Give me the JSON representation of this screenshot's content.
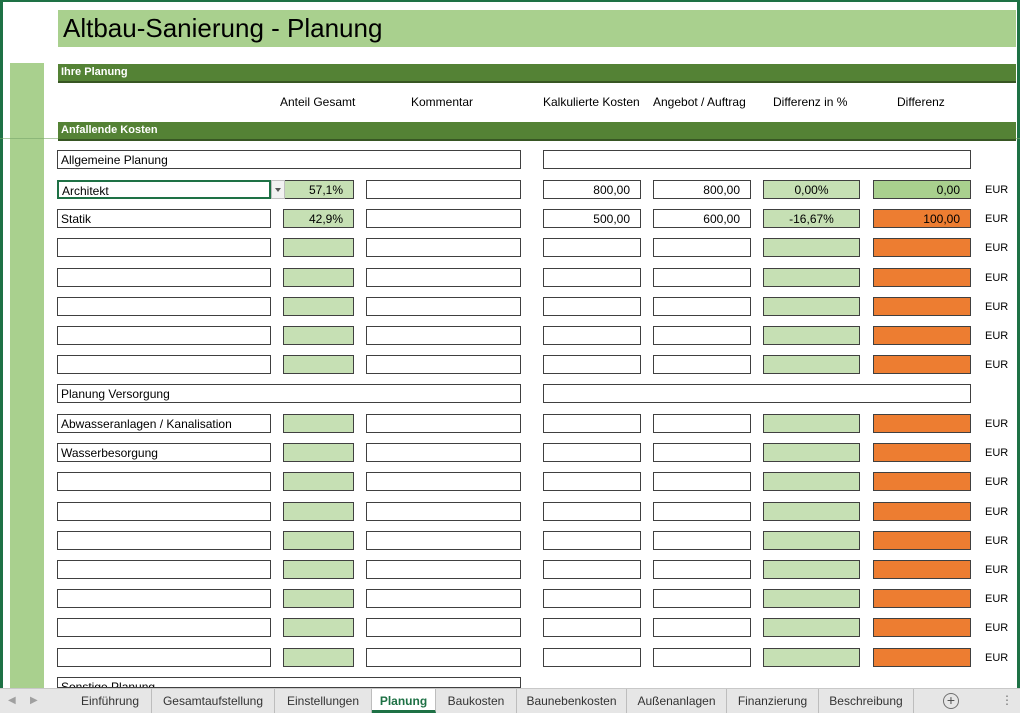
{
  "title": "Altbau-Sanierung - Planung",
  "sections": {
    "planning": "Ihre Planung",
    "costs": "Anfallende Kosten"
  },
  "columns": [
    "Anteil Gesamt",
    "Kommentar",
    "Kalkulierte Kosten",
    "Angebot / Auftrag",
    "Differenz in %",
    "Differenz"
  ],
  "currency": "EUR",
  "groups": [
    {
      "label": "Allgemeine Planung"
    },
    {
      "label": "Planung Versorgung"
    },
    {
      "label": "Sonstige Planung"
    }
  ],
  "rows": [
    {
      "name": "Architekt",
      "anteil": "57,1%",
      "kommentar": "",
      "kalkuliert": "800,00",
      "angebot": "800,00",
      "diff_pct": "0,00%",
      "diff": "0,00"
    },
    {
      "name": "Statik",
      "anteil": "42,9%",
      "kommentar": "",
      "kalkuliert": "500,00",
      "angebot": "600,00",
      "diff_pct": "-16,67%",
      "diff": "100,00"
    },
    {
      "name": "",
      "anteil": "",
      "kommentar": "",
      "kalkuliert": "",
      "angebot": "",
      "diff_pct": "",
      "diff": ""
    },
    {
      "name": "",
      "anteil": "",
      "kommentar": "",
      "kalkuliert": "",
      "angebot": "",
      "diff_pct": "",
      "diff": ""
    },
    {
      "name": "",
      "anteil": "",
      "kommentar": "",
      "kalkuliert": "",
      "angebot": "",
      "diff_pct": "",
      "diff": ""
    },
    {
      "name": "",
      "anteil": "",
      "kommentar": "",
      "kalkuliert": "",
      "angebot": "",
      "diff_pct": "",
      "diff": ""
    },
    {
      "name": "",
      "anteil": "",
      "kommentar": "",
      "kalkuliert": "",
      "angebot": "",
      "diff_pct": "",
      "diff": ""
    },
    {
      "name": "Abwasseranlagen / Kanalisation",
      "anteil": "",
      "kommentar": "",
      "kalkuliert": "",
      "angebot": "",
      "diff_pct": "",
      "diff": ""
    },
    {
      "name": "Wasserbesorgung",
      "anteil": "",
      "kommentar": "",
      "kalkuliert": "",
      "angebot": "",
      "diff_pct": "",
      "diff": ""
    },
    {
      "name": "",
      "anteil": "",
      "kommentar": "",
      "kalkuliert": "",
      "angebot": "",
      "diff_pct": "",
      "diff": ""
    },
    {
      "name": "",
      "anteil": "",
      "kommentar": "",
      "kalkuliert": "",
      "angebot": "",
      "diff_pct": "",
      "diff": ""
    },
    {
      "name": "",
      "anteil": "",
      "kommentar": "",
      "kalkuliert": "",
      "angebot": "",
      "diff_pct": "",
      "diff": ""
    },
    {
      "name": "",
      "anteil": "",
      "kommentar": "",
      "kalkuliert": "",
      "angebot": "",
      "diff_pct": "",
      "diff": ""
    },
    {
      "name": "",
      "anteil": "",
      "kommentar": "",
      "kalkuliert": "",
      "angebot": "",
      "diff_pct": "",
      "diff": ""
    },
    {
      "name": "",
      "anteil": "",
      "kommentar": "",
      "kalkuliert": "",
      "angebot": "",
      "diff_pct": "",
      "diff": ""
    },
    {
      "name": "",
      "anteil": "",
      "kommentar": "",
      "kalkuliert": "",
      "angebot": "",
      "diff_pct": "",
      "diff": ""
    }
  ],
  "tabs": [
    "Einführung",
    "Gesamtaufstellung",
    "Einstellungen",
    "Planung",
    "Baukosten",
    "Baunebenkosten",
    "Außenanlagen",
    "Finanzierung",
    "Beschreibung"
  ],
  "active_tab": "Planung",
  "colors": {
    "green_dark": "#548235",
    "green_light": "#c6e0b4",
    "green_mid": "#a9d08e",
    "orange": "#ed7d31",
    "excel_green": "#1e7145"
  }
}
